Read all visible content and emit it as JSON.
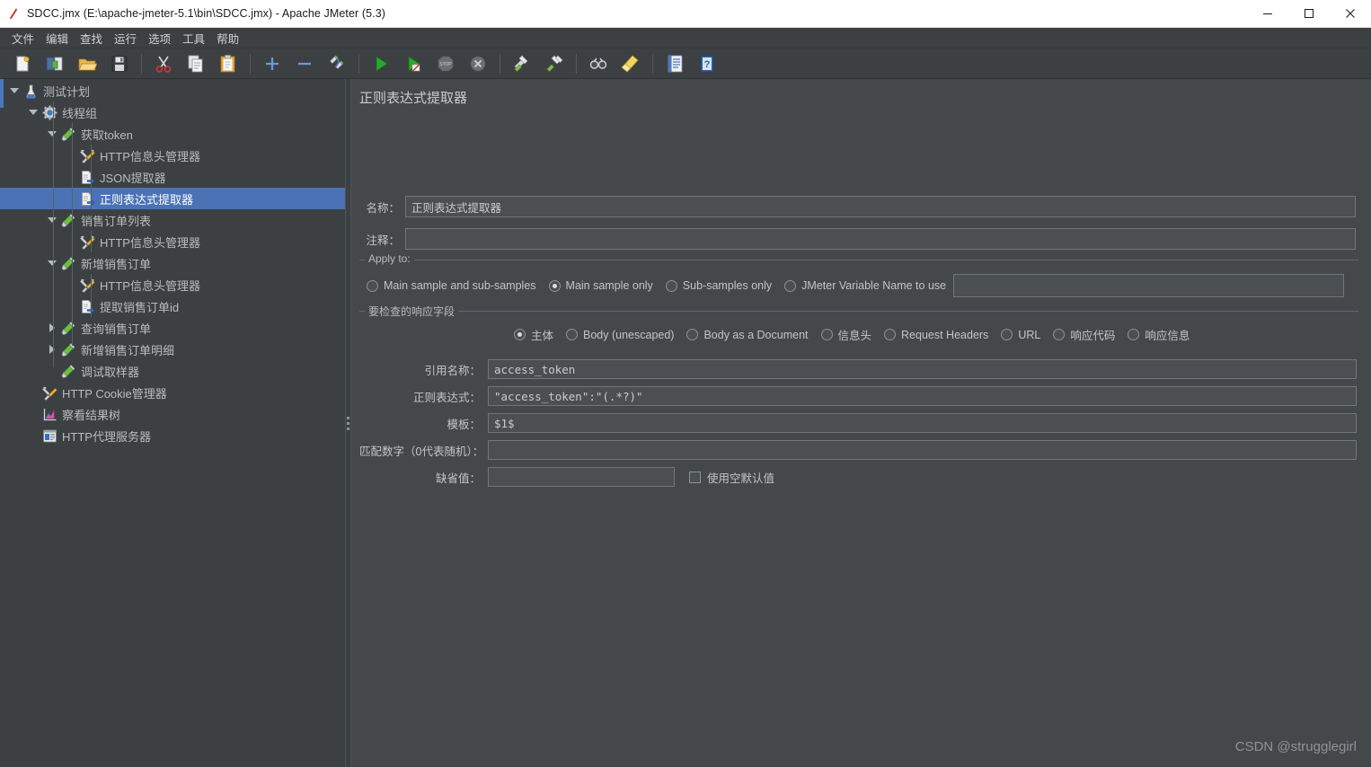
{
  "window": {
    "title": "SDCC.jmx (E:\\apache-jmeter-5.1\\bin\\SDCC.jmx) - Apache JMeter (5.3)",
    "app_icon": "jmeter-feather-icon",
    "minimize": "—",
    "maximize": "□",
    "close": "✕"
  },
  "menubar": {
    "items": [
      {
        "label": "文件"
      },
      {
        "label": "编辑"
      },
      {
        "label": "查找"
      },
      {
        "label": "运行"
      },
      {
        "label": "选项"
      },
      {
        "label": "工具"
      },
      {
        "label": "帮助"
      }
    ]
  },
  "toolbar": {
    "buttons": [
      {
        "name": "new-icon",
        "group": 0
      },
      {
        "name": "templates-icon",
        "group": 0
      },
      {
        "name": "open-icon",
        "group": 0
      },
      {
        "name": "save-icon",
        "group": 0
      },
      {
        "name": "cut-icon",
        "group": 1
      },
      {
        "name": "copy-icon",
        "group": 1
      },
      {
        "name": "paste-icon",
        "group": 1
      },
      {
        "name": "expand-all-icon",
        "group": 2
      },
      {
        "name": "collapse-all-icon",
        "group": 2
      },
      {
        "name": "toggle-enable-icon",
        "group": 2
      },
      {
        "name": "start-icon",
        "group": 3
      },
      {
        "name": "start-no-pauses-icon",
        "group": 3
      },
      {
        "name": "stop-icon",
        "group": 3
      },
      {
        "name": "shutdown-icon",
        "group": 3
      },
      {
        "name": "clear-icon",
        "group": 4
      },
      {
        "name": "clear-all-icon",
        "group": 4
      },
      {
        "name": "search-icon",
        "group": 5
      },
      {
        "name": "reset-search-icon",
        "group": 5
      },
      {
        "name": "function-helper-icon",
        "group": 6
      },
      {
        "name": "help-icon",
        "group": 6
      }
    ]
  },
  "tree": {
    "nodes": [
      {
        "label": "测试计划",
        "depth": 0,
        "icon": "test-plan-icon",
        "toggle": "down",
        "selected": false
      },
      {
        "label": "线程组",
        "depth": 1,
        "icon": "thread-group-icon",
        "toggle": "down",
        "selected": false
      },
      {
        "label": "获取token",
        "depth": 2,
        "icon": "http-sampler-icon",
        "toggle": "down",
        "selected": false
      },
      {
        "label": "HTTP信息头管理器",
        "depth": 3,
        "icon": "header-manager-icon",
        "toggle": "none",
        "selected": false
      },
      {
        "label": "JSON提取器",
        "depth": 3,
        "icon": "post-processor-icon",
        "toggle": "none",
        "selected": false
      },
      {
        "label": "正则表达式提取器",
        "depth": 3,
        "icon": "post-processor-icon",
        "toggle": "none",
        "selected": true
      },
      {
        "label": "销售订单列表",
        "depth": 2,
        "icon": "http-sampler-icon",
        "toggle": "down",
        "selected": false
      },
      {
        "label": "HTTP信息头管理器",
        "depth": 3,
        "icon": "header-manager-icon",
        "toggle": "none",
        "selected": false
      },
      {
        "label": "新增销售订单",
        "depth": 2,
        "icon": "http-sampler-icon",
        "toggle": "down",
        "selected": false
      },
      {
        "label": "HTTP信息头管理器",
        "depth": 3,
        "icon": "header-manager-icon",
        "toggle": "none",
        "selected": false
      },
      {
        "label": "提取销售订单id",
        "depth": 3,
        "icon": "post-processor-icon",
        "toggle": "none",
        "selected": false
      },
      {
        "label": "查询销售订单",
        "depth": 2,
        "icon": "http-sampler-icon",
        "toggle": "right",
        "selected": false
      },
      {
        "label": "新增销售订单明细",
        "depth": 2,
        "icon": "http-sampler-icon",
        "toggle": "right",
        "selected": false
      },
      {
        "label": "调试取样器",
        "depth": 2,
        "icon": "http-sampler-icon",
        "toggle": "none",
        "selected": false
      },
      {
        "label": "HTTP Cookie管理器",
        "depth": 1,
        "icon": "cookie-manager-icon",
        "toggle": "none",
        "selected": false
      },
      {
        "label": "察看结果树",
        "depth": 1,
        "icon": "view-results-icon",
        "toggle": "none",
        "selected": false
      },
      {
        "label": "HTTP代理服务器",
        "depth": 1,
        "icon": "http-proxy-icon",
        "toggle": "none",
        "selected": false
      }
    ]
  },
  "detail": {
    "panel_title": "正则表达式提取器",
    "name_label": "名称：",
    "name_value": "正则表达式提取器",
    "comment_label": "注释：",
    "comment_value": "",
    "apply_to": {
      "title": "Apply to:",
      "options": [
        {
          "label": "Main sample and sub-samples",
          "selected": false
        },
        {
          "label": "Main sample only",
          "selected": true
        },
        {
          "label": "Sub-samples only",
          "selected": false
        },
        {
          "label": "JMeter Variable Name to use",
          "selected": false
        }
      ],
      "variable_value": ""
    },
    "response_field": {
      "title": "要检查的响应字段",
      "options": [
        {
          "label": "主体",
          "selected": true
        },
        {
          "label": "Body (unescaped)",
          "selected": false
        },
        {
          "label": "Body as a Document",
          "selected": false
        },
        {
          "label": "信息头",
          "selected": false
        },
        {
          "label": "Request Headers",
          "selected": false
        },
        {
          "label": "URL",
          "selected": false
        },
        {
          "label": "响应代码",
          "selected": false
        },
        {
          "label": "响应信息",
          "selected": false
        }
      ]
    },
    "fields": [
      {
        "label": "引用名称：",
        "value": "access_token"
      },
      {
        "label": "正则表达式：",
        "value": "\"access_token\":\"(.*?)\""
      },
      {
        "label": "模板：",
        "value": "$1$"
      },
      {
        "label": "匹配数字（0代表随机）：",
        "value": ""
      }
    ],
    "default_label": "缺省值：",
    "default_value": "",
    "use_empty_default_label": "使用空默认值",
    "use_empty_default_checked": false
  },
  "watermark": "CSDN @strugglegirl",
  "colors": {
    "selection": "#4a72b5",
    "panel_bg": "#44488b",
    "tree_bg": "#3c4043",
    "accent": "#4a76bd"
  }
}
